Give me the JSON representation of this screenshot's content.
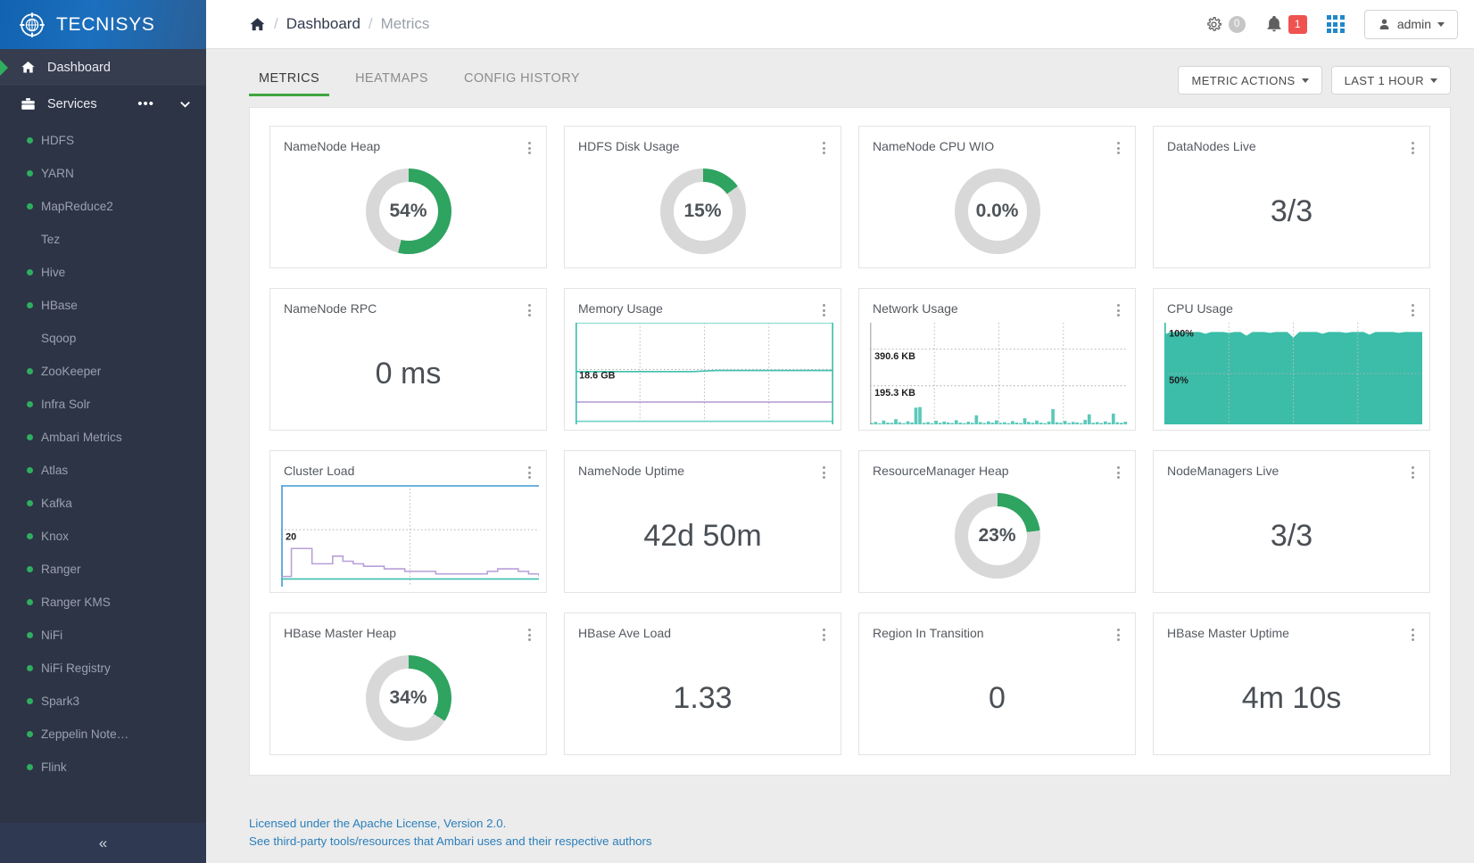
{
  "brand": {
    "name": "TECNISYS",
    "logo_icon": "compass-globe-icon"
  },
  "sidebar": {
    "nav": [
      {
        "label": "Dashboard",
        "icon": "home-icon",
        "active": true
      },
      {
        "label": "Services",
        "icon": "briefcase-icon",
        "active": false,
        "more_icon": "ellipsis-icon",
        "caret_icon": "chevron-down-icon"
      }
    ],
    "services": [
      {
        "label": "HDFS",
        "status": "green"
      },
      {
        "label": "YARN",
        "status": "green"
      },
      {
        "label": "MapReduce2",
        "status": "green"
      },
      {
        "label": "Tez",
        "status": "none"
      },
      {
        "label": "Hive",
        "status": "green"
      },
      {
        "label": "HBase",
        "status": "green"
      },
      {
        "label": "Sqoop",
        "status": "none"
      },
      {
        "label": "ZooKeeper",
        "status": "green"
      },
      {
        "label": "Infra Solr",
        "status": "green"
      },
      {
        "label": "Ambari Metrics",
        "status": "green"
      },
      {
        "label": "Atlas",
        "status": "green"
      },
      {
        "label": "Kafka",
        "status": "green"
      },
      {
        "label": "Knox",
        "status": "green"
      },
      {
        "label": "Ranger",
        "status": "green"
      },
      {
        "label": "Ranger KMS",
        "status": "green"
      },
      {
        "label": "NiFi",
        "status": "green"
      },
      {
        "label": "NiFi Registry",
        "status": "green"
      },
      {
        "label": "Spark3",
        "status": "green"
      },
      {
        "label": "Zeppelin Note…",
        "status": "green"
      },
      {
        "label": "Flink",
        "status": "green"
      }
    ],
    "collapse_icon": "double-chevron-left-icon",
    "status_color": "#2fae5f"
  },
  "header": {
    "breadcrumb": {
      "home_icon": "home-icon",
      "sep": "/",
      "parent": "Dashboard",
      "current": "Metrics"
    },
    "gear_icon": "gear-icon",
    "gear_count": "0",
    "bell_icon": "bell-icon",
    "alert_count": "1",
    "alert_color": "#ef5350",
    "apps_icon": "grid-apps-icon",
    "user": {
      "icon": "person-icon",
      "label": "admin",
      "caret": "caret-down-icon"
    }
  },
  "tabs": [
    {
      "label": "METRICS",
      "active": true
    },
    {
      "label": "HEATMAPS",
      "active": false
    },
    {
      "label": "CONFIG HISTORY",
      "active": false
    }
  ],
  "toolbar": {
    "metric_actions": "METRIC ACTIONS",
    "time_range": "LAST 1 HOUR",
    "caret_icon": "caret-down-icon"
  },
  "accent": {
    "green": "#2fa360",
    "teal": "#3fbfae",
    "blue": "#5ba7d8",
    "purple": "#b79fd8",
    "track": "#d8d8d8"
  },
  "cards": [
    {
      "title": "NameNode Heap",
      "kind": "donut",
      "value": "54%",
      "pct": 54
    },
    {
      "title": "HDFS Disk Usage",
      "kind": "donut",
      "value": "15%",
      "pct": 15
    },
    {
      "title": "NameNode CPU WIO",
      "kind": "donut",
      "value": "0.0%",
      "pct": 0
    },
    {
      "title": "DataNodes Live",
      "kind": "number",
      "value": "3/3"
    },
    {
      "title": "NameNode RPC",
      "kind": "number",
      "value": "0 ms"
    },
    {
      "title": "Memory Usage",
      "kind": "chart",
      "chart": "memory"
    },
    {
      "title": "Network Usage",
      "kind": "chart",
      "chart": "network"
    },
    {
      "title": "CPU Usage",
      "kind": "chart",
      "chart": "cpu"
    },
    {
      "title": "Cluster Load",
      "kind": "chart",
      "chart": "load"
    },
    {
      "title": "NameNode Uptime",
      "kind": "number",
      "value": "42d 50m"
    },
    {
      "title": "ResourceManager Heap",
      "kind": "donut",
      "value": "23%",
      "pct": 23
    },
    {
      "title": "NodeManagers Live",
      "kind": "number",
      "value": "3/3"
    },
    {
      "title": "HBase Master Heap",
      "kind": "donut",
      "value": "34%",
      "pct": 34
    },
    {
      "title": "HBase Ave Load",
      "kind": "number",
      "value": "1.33"
    },
    {
      "title": "Region In Transition",
      "kind": "number",
      "value": "0"
    },
    {
      "title": "HBase Master Uptime",
      "kind": "number",
      "value": "4m 10s"
    }
  ],
  "chart_data": [
    {
      "id": "memory",
      "type": "line",
      "title": "Memory Usage",
      "axis_labels": [
        "18.6 GB"
      ],
      "grid": true,
      "legend": "none",
      "series": [
        {
          "name": "total",
          "color": "#6fd3c4",
          "values": [
            100,
            100,
            100,
            100,
            100,
            100,
            100,
            100,
            100,
            100,
            100,
            100
          ]
        },
        {
          "name": "used",
          "color": "#3fbfae",
          "values": [
            52,
            52,
            52,
            52,
            52,
            52,
            53,
            53,
            53,
            53,
            53,
            53
          ]
        },
        {
          "name": "cached",
          "color": "#b79fd8",
          "values": [
            22,
            22,
            22,
            22,
            22,
            22,
            22,
            22,
            22,
            22,
            22,
            22
          ]
        },
        {
          "name": "swap",
          "color": "#6fd3c4",
          "values": [
            3,
            3,
            3,
            3,
            3,
            3,
            3,
            3,
            3,
            3,
            3,
            3
          ]
        }
      ],
      "ylim": [
        0,
        100
      ]
    },
    {
      "id": "network",
      "type": "area",
      "title": "Network Usage",
      "axis_labels": [
        "390.6 KB",
        "195.3 KB"
      ],
      "grid": true,
      "series": [
        {
          "name": "bytes_in",
          "color": "#3fbfae",
          "values": [
            8,
            14,
            6,
            22,
            10,
            9,
            30,
            12,
            7,
            18,
            11,
            96,
            100,
            9,
            13,
            7,
            21,
            9,
            16,
            11,
            8,
            24,
            10,
            7,
            15,
            9,
            52,
            13,
            8,
            17,
            10,
            23,
            9,
            12,
            7,
            19,
            11,
            8,
            35,
            14,
            9,
            22,
            10,
            7,
            16,
            88,
            12,
            9,
            20,
            8,
            14,
            11,
            7,
            26,
            58,
            9,
            13,
            8,
            17,
            10,
            62,
            12,
            9,
            15
          ]
        }
      ],
      "ylim": [
        0,
        585
      ]
    },
    {
      "id": "cpu",
      "type": "area",
      "title": "CPU Usage",
      "axis_labels": [
        "100%",
        "50%"
      ],
      "grid": true,
      "series": [
        {
          "name": "cpu_total",
          "color": "#3bbda9",
          "values": [
            97,
            100,
            100,
            100,
            99,
            100,
            100,
            98,
            100,
            100,
            100,
            99,
            100,
            100,
            96,
            100,
            100,
            100,
            99,
            100,
            100,
            100,
            94,
            100,
            100,
            100,
            100,
            98,
            100,
            100,
            100,
            99,
            100,
            100,
            100,
            97,
            100,
            100,
            100,
            100,
            99,
            100,
            100,
            100,
            100
          ]
        }
      ],
      "ylim": [
        0,
        110
      ]
    },
    {
      "id": "load",
      "type": "line",
      "title": "Cluster Load",
      "axis_labels": [
        "20"
      ],
      "grid": true,
      "series": [
        {
          "name": "nodes_total",
          "color": "#5ba7d8",
          "values": [
            40,
            40,
            40,
            40,
            40,
            40,
            40,
            40,
            40,
            40,
            40,
            40
          ]
        },
        {
          "name": "cpu_1min",
          "color": "#b79fd8",
          "values": [
            4,
            15,
            15,
            9,
            9,
            12,
            10,
            9,
            8,
            8,
            7,
            7,
            6,
            6,
            6,
            5,
            5,
            5,
            5,
            5,
            6,
            7,
            7,
            6,
            5,
            4
          ]
        },
        {
          "name": "nodes_active",
          "color": "#3fbfae",
          "values": [
            3,
            3,
            3,
            3,
            3,
            3,
            3,
            3,
            3,
            3,
            3,
            3,
            3,
            3,
            3,
            3,
            3,
            3,
            3,
            3,
            3,
            3,
            3,
            3,
            3,
            3
          ]
        }
      ],
      "ylim": [
        0,
        40
      ]
    }
  ],
  "footer": {
    "line1": "Licensed under the Apache License, Version 2.0.",
    "line2": "See third-party tools/resources that Ambari uses and their respective authors"
  }
}
